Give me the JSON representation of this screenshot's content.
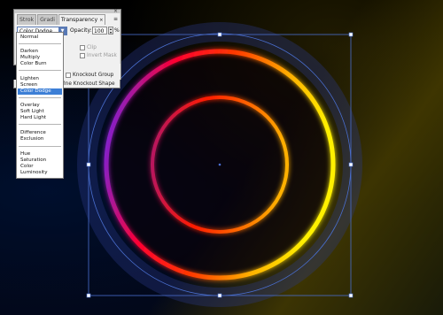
{
  "panel": {
    "tabs": [
      {
        "label": "Strok"
      },
      {
        "label": "Gradi"
      },
      {
        "label": "Transparency",
        "close": "×"
      }
    ],
    "menu_icon": "≡",
    "close_icon": "×",
    "blend_mode": "Color Dodge",
    "opacity_label": "Opacity:",
    "opacity_value": "100",
    "opacity_unit": "%",
    "clip_label": "Clip",
    "invert_mask_label": "Invert Mask",
    "knockout_group_label": "Knockout Group",
    "knockout_shape_label": "fine Knockout Shape"
  },
  "blend_modes": {
    "group1": [
      "Normal"
    ],
    "group2": [
      "Darken",
      "Multiply",
      "Color Burn"
    ],
    "group3": [
      "Lighten",
      "Screen",
      "Color Dodge"
    ],
    "group4": [
      "Overlay",
      "Soft Light",
      "Hard Light"
    ],
    "group5": [
      "Difference",
      "Exclusion"
    ],
    "group6": [
      "Hue",
      "Saturation",
      "Color",
      "Luminosity"
    ],
    "selected": "Color Dodge"
  },
  "colors": {
    "selection": "#4a6fd0",
    "highlight": "#3d7fd6",
    "ring_warm": "#ffd400",
    "ring_hot": "#ff2a00",
    "ring_cool": "#6a2cff"
  }
}
